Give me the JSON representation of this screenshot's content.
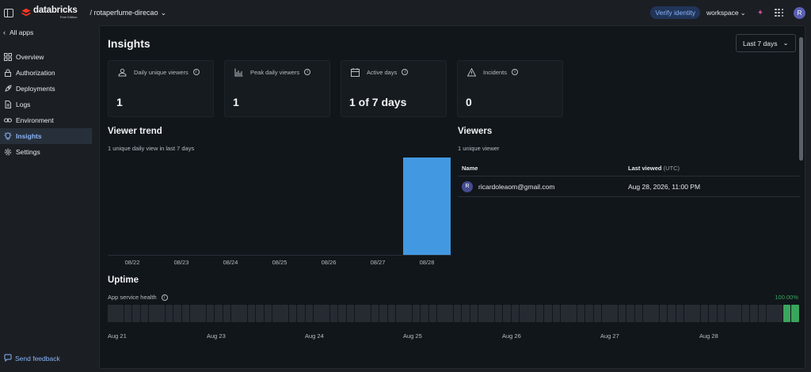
{
  "topbar": {
    "brand": "databricks",
    "edition": "Free Edition",
    "app_path": "/ rotaperfume-direcao",
    "verify_label": "Verify identity",
    "workspace_label": "workspace",
    "avatar_initial": "R"
  },
  "sidebar": {
    "back_label": "All apps",
    "items": [
      {
        "label": "Overview",
        "icon": "grid-icon"
      },
      {
        "label": "Authorization",
        "icon": "lock-icon"
      },
      {
        "label": "Deployments",
        "icon": "rocket-icon"
      },
      {
        "label": "Logs",
        "icon": "file-icon"
      },
      {
        "label": "Environment",
        "icon": "link-icon"
      },
      {
        "label": "Insights",
        "icon": "lightbulb-icon",
        "active": true
      },
      {
        "label": "Settings",
        "icon": "gear-icon"
      }
    ],
    "feedback_label": "Send feedback"
  },
  "main": {
    "title": "Insights",
    "range_label": "Last 7 days",
    "cards": [
      {
        "label": "Daily unique viewers",
        "value": "1",
        "icon": "user-icon"
      },
      {
        "label": "Peak daily viewers",
        "value": "1",
        "icon": "bar-chart-icon"
      },
      {
        "label": "Active days",
        "value": "1 of 7 days",
        "icon": "calendar-icon"
      },
      {
        "label": "Incidents",
        "value": "0",
        "icon": "warning-icon"
      }
    ],
    "viewer_trend": {
      "title": "Viewer trend",
      "subtitle": "1 unique daily view in last 7 days"
    },
    "viewers": {
      "title": "Viewers",
      "subtitle": "1 unique viewer",
      "col_name": "Name",
      "col_last_viewed": "Last viewed",
      "col_tz": "(UTC)",
      "rows": [
        {
          "initial": "R",
          "email": "ricardoleaom@gmail.com",
          "last_viewed": "Aug 28, 2026, 11:00 PM"
        }
      ]
    },
    "uptime": {
      "title": "Uptime",
      "health_label": "App service health",
      "percent": "100.00%",
      "date_labels": [
        "Aug 21",
        "Aug 23",
        "Aug 24",
        "Aug 25",
        "Aug 26",
        "Aug 27",
        "Aug 28"
      ],
      "total_slots": 84,
      "healthy_slots": 2
    }
  },
  "colors": {
    "accent": "#8ab4f8",
    "bar": "#4299e1",
    "healthy": "#3aa55d",
    "brand": "#ff3621"
  },
  "chart_data": {
    "type": "bar",
    "categories": [
      "08/22",
      "08/23",
      "08/24",
      "08/25",
      "08/26",
      "08/27",
      "08/28"
    ],
    "values": [
      0,
      0,
      0,
      0,
      0,
      0,
      1
    ],
    "title": "Viewer trend",
    "xlabel": "",
    "ylabel": "",
    "ylim": [
      0,
      1
    ],
    "grid": false
  }
}
